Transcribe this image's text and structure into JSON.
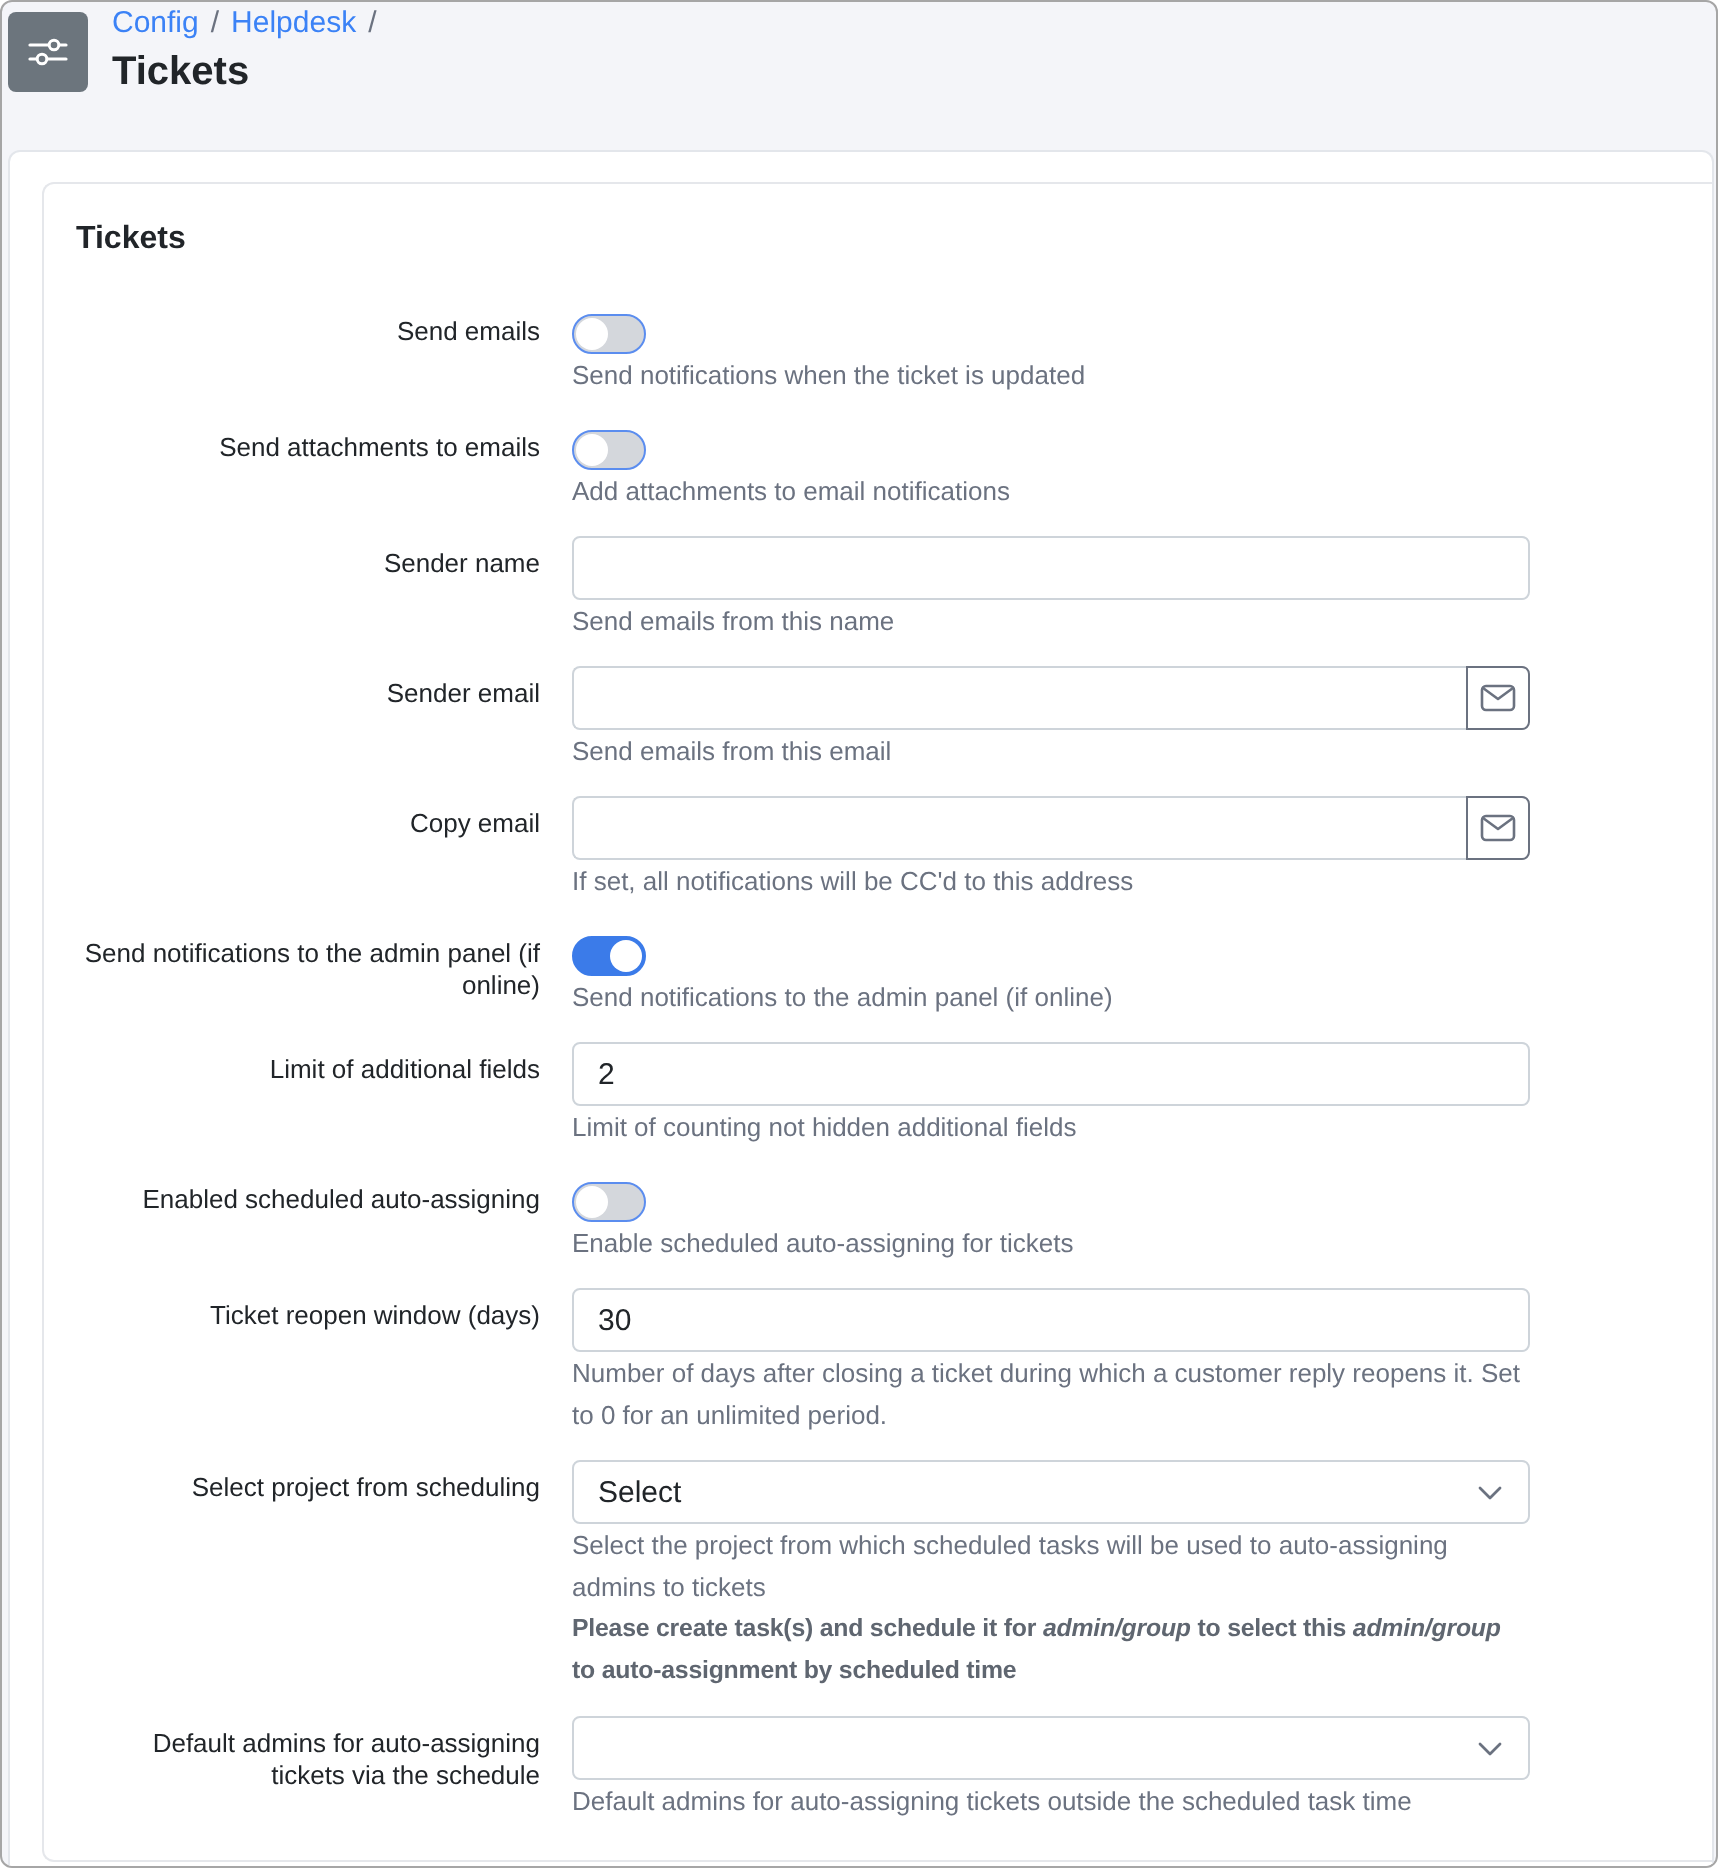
{
  "header": {
    "breadcrumbs": [
      {
        "label": "Config",
        "separator": "/"
      },
      {
        "label": "Helpdesk",
        "separator": "/"
      }
    ],
    "title": "Tickets"
  },
  "card": {
    "title": "Tickets",
    "fields": [
      {
        "kind": "toggle",
        "label": "Send emails",
        "on": false,
        "hint": "Send notifications when the ticket is updated"
      },
      {
        "kind": "toggle",
        "label": "Send attachments to emails",
        "on": false,
        "hint": "Add attachments to email notifications"
      },
      {
        "kind": "text",
        "label": "Sender name",
        "hint": "Send emails from this name"
      },
      {
        "kind": "email",
        "label": "Sender email",
        "hint": "Send emails from this email"
      },
      {
        "kind": "email",
        "label": "Copy email",
        "hint": "If set, all notifications will be CC'd to this address"
      },
      {
        "kind": "toggle",
        "label": "Send notifications to the admin panel (if online)",
        "on": true,
        "hint": "Send notifications to the admin panel (if online)"
      },
      {
        "kind": "text",
        "label": "Limit of additional fields",
        "value": "2",
        "hint": "Limit of counting not hidden additional fields"
      },
      {
        "kind": "toggle",
        "label": "Enabled scheduled auto-assigning",
        "on": false,
        "hint": "Enable scheduled auto-assigning for tickets"
      },
      {
        "kind": "text",
        "label": "Ticket reopen window (days)",
        "value": "30",
        "hint": "Number of days after closing a ticket during which a customer reply reopens it. Set to 0 for an unlimited period."
      },
      {
        "kind": "select",
        "label": "Select project from scheduling",
        "value": "Select",
        "hint": "Select the project from which scheduled tasks will be used to auto-assigning admins to tickets",
        "note": "Please create task(s) and schedule it for *admin/group* to select this *admin/group* to auto-assignment by scheduled time"
      },
      {
        "kind": "select",
        "label": "Default admins for auto-assigning tickets via the schedule",
        "hint": "Default admins for auto-assigning tickets outside the scheduled task time"
      }
    ]
  }
}
